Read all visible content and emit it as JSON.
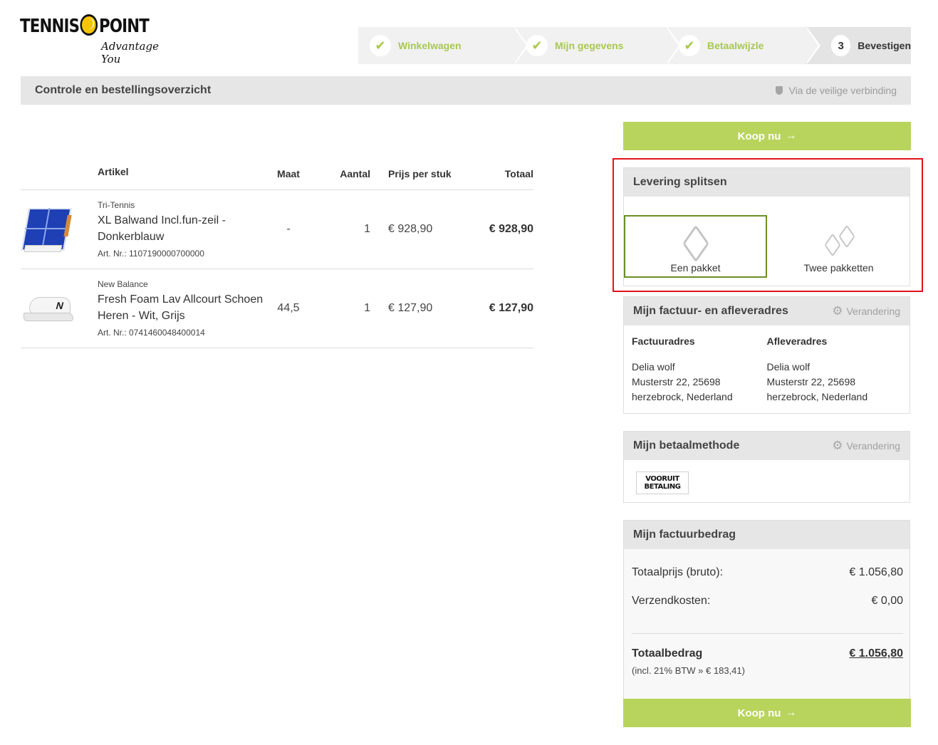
{
  "header": {
    "logo_main_left": "TENNIS",
    "logo_main_right": "POINT",
    "logo_tagline": "Advantage You",
    "steps": [
      {
        "label": "Winkelwagen",
        "state": "done"
      },
      {
        "label": "Mijn gegevens",
        "state": "done"
      },
      {
        "label": "Betaalwijzle",
        "state": "done"
      },
      {
        "number": "3",
        "label": "Bevestigen",
        "state": "current"
      }
    ],
    "accent_color": "#b9d45c"
  },
  "title_bar": {
    "title": "Controle en bestellingsoverzicht",
    "secure_text": "Via de veilige verbinding"
  },
  "cart": {
    "columns": {
      "artikel": "Artikel",
      "maat": "Maat",
      "aantal": "Aantal",
      "prijs": "Prijs per stuk",
      "totaal": "Totaal"
    },
    "items": [
      {
        "brand": "Tri-Tennis",
        "name": "XL Balwand Incl.fun-zeil - Donkerblauw",
        "artnr": "Art. Nr.: 1107190000700000",
        "maat": "-",
        "aantal": "1",
        "prijs": "€ 928,90",
        "totaal": "€ 928,90",
        "image_icon": "court-wall-image"
      },
      {
        "brand": "New Balance",
        "name": "Fresh Foam Lav Allcourt Schoen Heren - Wit, Grijs",
        "artnr": "Art. Nr.: 0741460048400014",
        "maat": "44,5",
        "aantal": "1",
        "prijs": "€ 127,90",
        "totaal": "€ 127,90",
        "image_icon": "shoe-image"
      }
    ]
  },
  "buy_button": {
    "label": "Koop nu",
    "arrow": "→"
  },
  "split_delivery": {
    "title": "Levering splitsen",
    "option_one": "Een pakket",
    "option_two": "Twee pakketten",
    "selected": "Een pakket"
  },
  "address": {
    "title": "Mijn factuur- en afleveradres",
    "change_label": "Verandering",
    "billing": {
      "heading": "Factuuradres",
      "name": "Delia wolf",
      "street": "Musterstr 22, 25698",
      "city": "herzebrock, Nederland"
    },
    "shipping": {
      "heading": "Afleveradres",
      "name": "Delia wolf",
      "street": "Musterstr 22, 25698",
      "city": "herzebrock, Nederland"
    }
  },
  "payment": {
    "title": "Mijn betaalmethode",
    "change_label": "Verandering",
    "badge_line1": "VOORUIT",
    "badge_line2": "BETALING"
  },
  "summary": {
    "title": "Mijn factuurbedrag",
    "gross_label": "Totaalprijs (bruto):",
    "gross_value": "€ 1.056,80",
    "shipping_label": "Verzendkosten:",
    "shipping_value": "€ 0,00",
    "total_label": "Totaalbedrag",
    "total_value": "€ 1.056,80",
    "vat_note": "(incl. 21% BTW » € 183,41)"
  }
}
